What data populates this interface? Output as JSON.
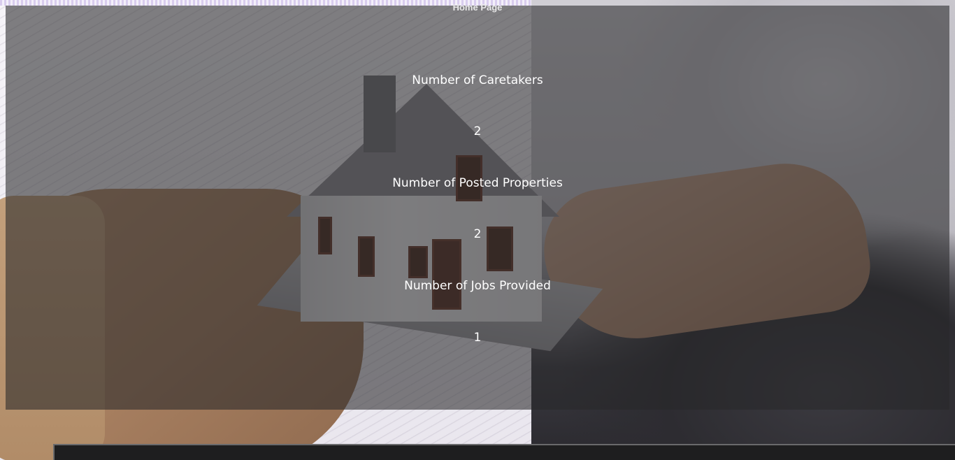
{
  "stats": [
    {
      "label": "Number of Caretakers",
      "value": "2"
    },
    {
      "label": "Number of Posted Properties",
      "value": "2"
    },
    {
      "label": "Number of Jobs Provided",
      "value": "1"
    }
  ],
  "footer": {
    "home_label": "Home Page"
  },
  "background": {
    "image_subject": "hands-holding-house-model",
    "overlay_color": "#28282a"
  }
}
